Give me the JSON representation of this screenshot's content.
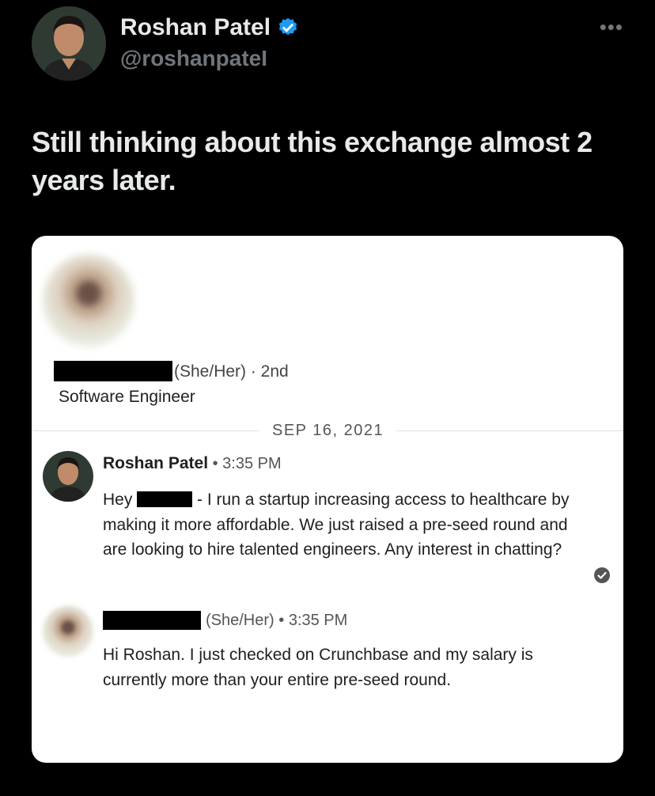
{
  "tweet": {
    "author_name": "Roshan Patel",
    "author_handle": "@roshanpateI",
    "more_icon": "more-horizontal-icon",
    "verified_icon": "verified-badge-icon",
    "text": "Still thinking about this exchange almost 2 years later."
  },
  "screenshot": {
    "profile": {
      "pronoun_degree": "(She/Her) · 2nd",
      "headline": "Software Engineer"
    },
    "date_separator": "SEP 16, 2021",
    "messages": [
      {
        "sender": "Roshan Patel",
        "meta": " • 3:35 PM",
        "body_prefix": "Hey",
        "body_rest": "- I run a startup increasing access to healthcare by making it more affordable. We just raised a pre-seed round and are looking to hire talented engineers. Any interest in chatting?"
      },
      {
        "sender_pronoun": "(She/Her)",
        "meta": " • 3:35 PM",
        "body": "Hi Roshan. I just checked on Crunchbase and my salary is currently more than your entire pre-seed round."
      }
    ]
  },
  "colors": {
    "background": "#000000",
    "verified": "#1d9bf0",
    "card": "#ffffff"
  }
}
